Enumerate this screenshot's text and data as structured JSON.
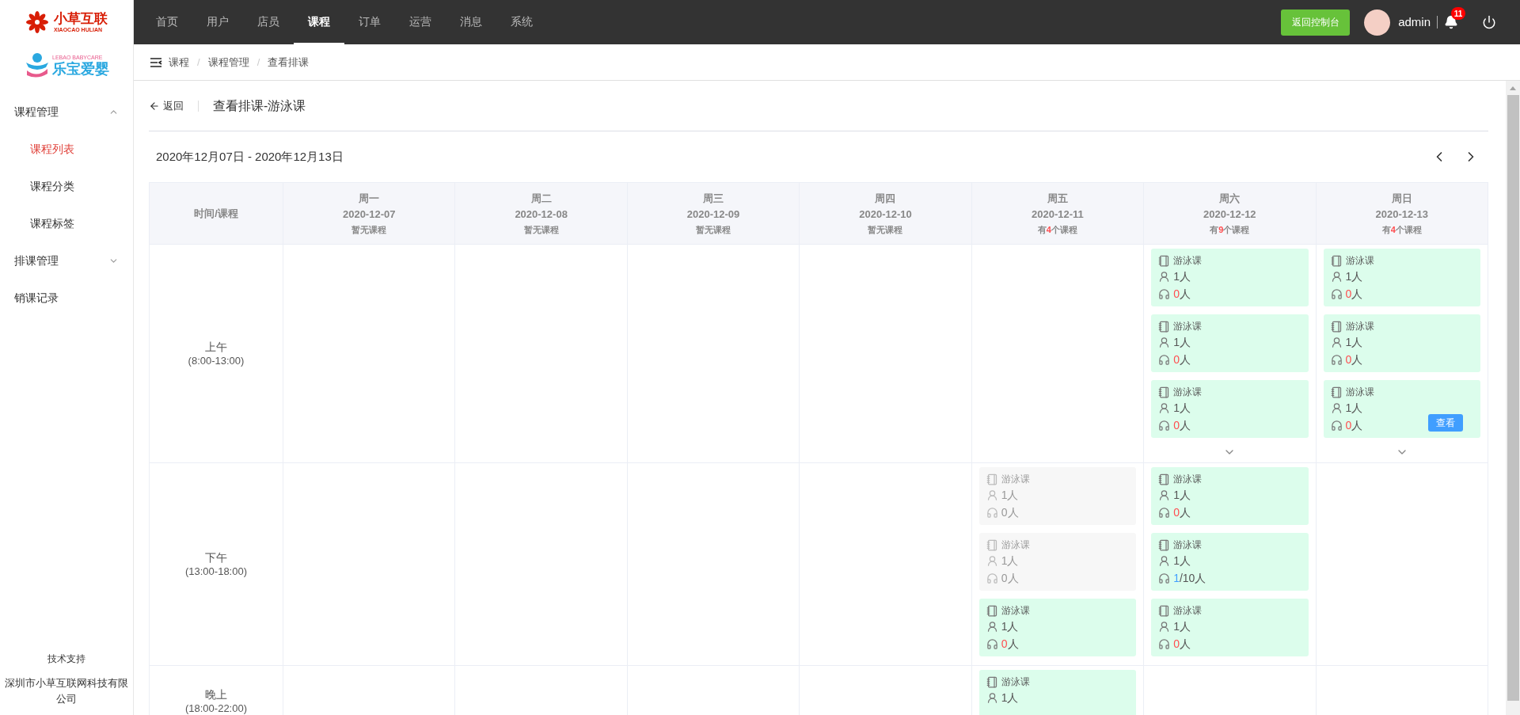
{
  "logos": {
    "primary": {
      "name": "小草互联",
      "subtitle": "XIAOCAO HULIAN"
    },
    "secondary": {
      "name": "乐宝爱婴",
      "subtitle": "LEBAO BABYCARE"
    }
  },
  "nav": [
    {
      "label": "首页",
      "selected": false
    },
    {
      "label": "用户",
      "selected": false
    },
    {
      "label": "店员",
      "selected": false
    },
    {
      "label": "课程",
      "selected": true
    },
    {
      "label": "订单",
      "selected": false
    },
    {
      "label": "运营",
      "selected": false
    },
    {
      "label": "消息",
      "selected": false
    },
    {
      "label": "系统",
      "selected": false
    }
  ],
  "header": {
    "console_button": "返回控制台",
    "user": "admin",
    "notification_count": "11"
  },
  "breadcrumb": [
    {
      "kind": "link",
      "text": "课程"
    },
    {
      "kind": "separator",
      "text": "/"
    },
    {
      "kind": "link",
      "text": "课程管理"
    },
    {
      "kind": "separator",
      "text": "/"
    },
    {
      "kind": "current",
      "text": "查看排课"
    }
  ],
  "sidebar": {
    "items": [
      {
        "label": "课程管理",
        "expanded": true,
        "children": [
          {
            "label": "课程列表",
            "selected": true
          },
          {
            "label": "课程分类",
            "selected": false
          },
          {
            "label": "课程标签",
            "selected": false
          }
        ]
      },
      {
        "label": "排课管理",
        "expanded": false
      },
      {
        "label": "销课记录"
      }
    ],
    "footer": {
      "title": "技术支持",
      "company": "深圳市小草互联网科技有限公司"
    }
  },
  "page": {
    "back": "返回",
    "title": "查看排课-游泳课",
    "date_range": "2020年12月07日 - 2020年12月13日"
  },
  "table": {
    "corner": "时间/课程",
    "days": [
      {
        "weekday": "周一",
        "date": "2020-12-07",
        "summary": {
          "kind": "none",
          "text": "暂无课程"
        }
      },
      {
        "weekday": "周二",
        "date": "2020-12-08",
        "summary": {
          "kind": "none",
          "text": "暂无课程"
        }
      },
      {
        "weekday": "周三",
        "date": "2020-12-09",
        "summary": {
          "kind": "none",
          "text": "暂无课程"
        }
      },
      {
        "weekday": "周四",
        "date": "2020-12-10",
        "summary": {
          "kind": "none",
          "text": "暂无课程"
        }
      },
      {
        "weekday": "周五",
        "date": "2020-12-11",
        "summary": {
          "kind": "count",
          "before": "有",
          "count": "4",
          "after": "个课程"
        }
      },
      {
        "weekday": "周六",
        "date": "2020-12-12",
        "summary": {
          "kind": "count",
          "before": "有",
          "count": "9",
          "after": "个课程"
        }
      },
      {
        "weekday": "周日",
        "date": "2020-12-13",
        "summary": {
          "kind": "count",
          "before": "有",
          "count": "4",
          "after": "个课程"
        }
      }
    ],
    "periods": [
      {
        "label": "上午",
        "range": "(8:00-13:00)",
        "cells": [
          {
            "more": false
          },
          {
            "more": false
          },
          {
            "more": false
          },
          {
            "more": false
          },
          {
            "more": false
          },
          {
            "more": true,
            "cards": [
              {
                "kind": "active",
                "course": "游泳课",
                "teacher": "1人",
                "booked": "0",
                "rest": "人",
                "color": "#ff4d4f"
              },
              {
                "kind": "active",
                "course": "游泳课",
                "teacher": "1人",
                "booked": "0",
                "rest": "人",
                "color": "#ff4d4f"
              },
              {
                "kind": "active",
                "course": "游泳课",
                "teacher": "1人",
                "booked": "0",
                "rest": "人",
                "color": "#ff4d4f"
              }
            ]
          },
          {
            "more": true,
            "cards": [
              {
                "kind": "active",
                "course": "游泳课",
                "teacher": "1人",
                "booked": "0",
                "rest": "人",
                "color": "#ff4d4f"
              },
              {
                "kind": "active",
                "course": "游泳课",
                "teacher": "1人",
                "booked": "0",
                "rest": "人",
                "color": "#ff4d4f"
              },
              {
                "kind": "active",
                "course": "游泳课",
                "teacher": "1人",
                "booked": "0",
                "rest": "人",
                "color": "#ff4d4f",
                "action": "查看"
              }
            ]
          }
        ]
      },
      {
        "label": "下午",
        "range": "(13:00-18:00)",
        "cells": [
          {
            "more": false
          },
          {
            "more": false
          },
          {
            "more": false
          },
          {
            "more": false
          },
          {
            "more": false,
            "cards": [
              {
                "kind": "ended",
                "course": "游泳课",
                "teacher": "1人",
                "booked": "0",
                "rest": "人"
              },
              {
                "kind": "ended",
                "course": "游泳课",
                "teacher": "1人",
                "booked": "0",
                "rest": "人"
              },
              {
                "kind": "active",
                "course": "游泳课",
                "teacher": "1人",
                "booked": "0",
                "rest": "人",
                "color": "#ff4d4f"
              }
            ]
          },
          {
            "more": false,
            "cards": [
              {
                "kind": "active",
                "course": "游泳课",
                "teacher": "1人",
                "booked": "0",
                "rest": "人",
                "color": "#ff4d4f"
              },
              {
                "kind": "active",
                "course": "游泳课",
                "teacher": "1人",
                "booked": "1",
                "rest": "/10人",
                "color": "#409eff"
              },
              {
                "kind": "active",
                "course": "游泳课",
                "teacher": "1人",
                "booked": "0",
                "rest": "人",
                "color": "#ff4d4f"
              }
            ]
          },
          {
            "more": false
          }
        ]
      },
      {
        "label": "晚上",
        "range": "(18:00-22:00)",
        "cells": [
          {
            "more": false
          },
          {
            "more": false
          },
          {
            "more": false
          },
          {
            "more": false
          },
          {
            "more": false,
            "cards": [
              {
                "kind": "active",
                "course": "游泳课",
                "teacher": "1人"
              }
            ]
          },
          {
            "more": false
          },
          {
            "more": false
          }
        ]
      }
    ]
  }
}
